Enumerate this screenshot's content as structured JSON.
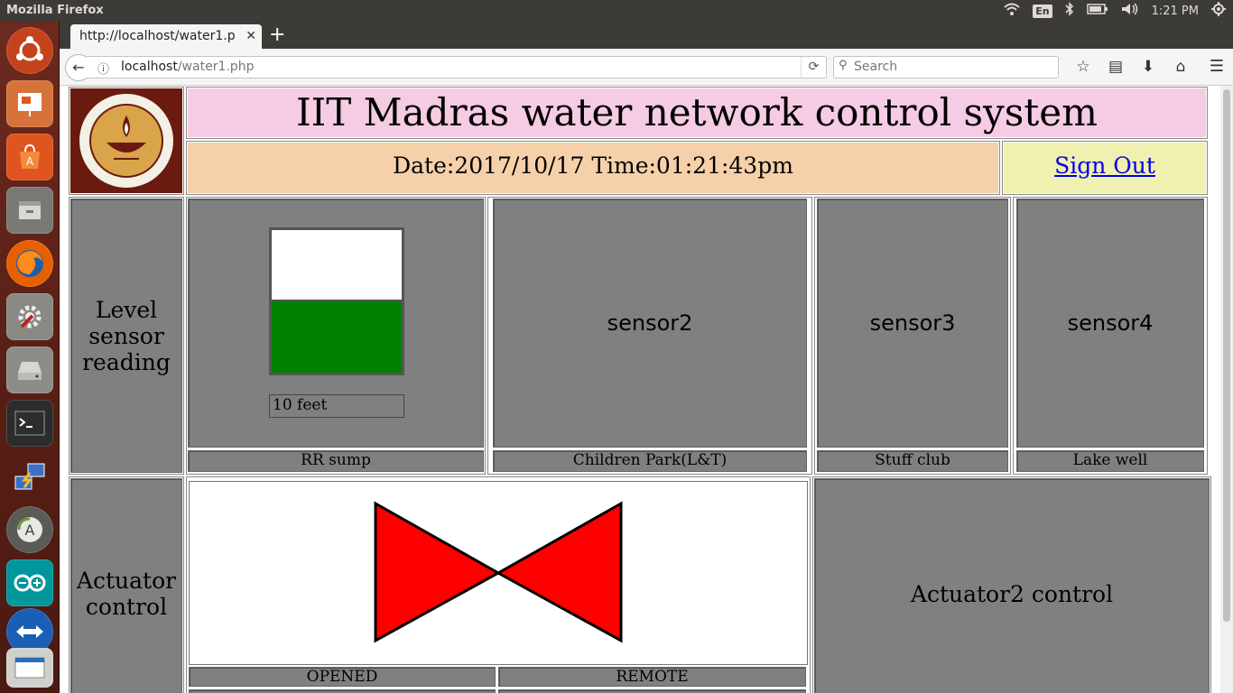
{
  "system": {
    "app_title": "Mozilla Firefox",
    "language": "En",
    "clock": "1:21 PM"
  },
  "browser": {
    "tab_title": "http://localhost/water1.p",
    "url_host": "localhost",
    "url_path": "/water1.php",
    "search_placeholder": "Search"
  },
  "page": {
    "title": "IIT Madras water network control system",
    "datetime": "Date:2017/10/17 Time:01:21:43pm",
    "signout": "Sign Out",
    "level_row_label": "Level sensor reading",
    "actuator_row_label": "Actuator control",
    "sensors": [
      {
        "name": "RR sump",
        "level_text": "10 feet",
        "fill_fraction": 0.5
      },
      {
        "name": "Children Park(L&T)",
        "display": "sensor2"
      },
      {
        "name": "Stuff club",
        "display": "sensor3"
      },
      {
        "name": "Lake well",
        "display": "sensor4"
      }
    ],
    "actuator1": {
      "state": "OPENED",
      "mode": "REMOTE",
      "valve_color": "#ff0000"
    },
    "actuator2": {
      "label": "Actuator2 control"
    }
  }
}
